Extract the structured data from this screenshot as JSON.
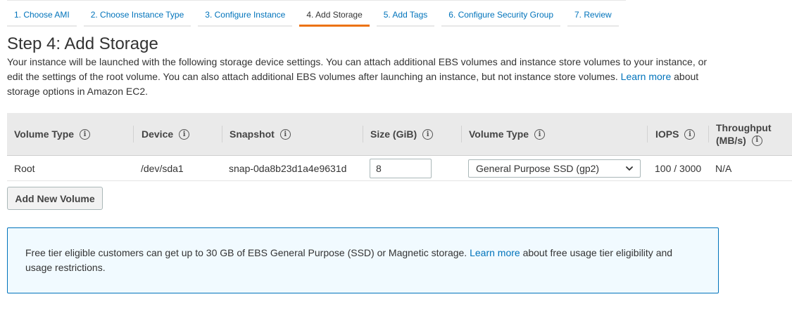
{
  "wizard": {
    "tabs": [
      {
        "label": "1. Choose AMI"
      },
      {
        "label": "2. Choose Instance Type"
      },
      {
        "label": "3. Configure Instance"
      },
      {
        "label": "4. Add Storage"
      },
      {
        "label": "5. Add Tags"
      },
      {
        "label": "6. Configure Security Group"
      },
      {
        "label": "7. Review"
      }
    ],
    "active_tab": "4. Add Storage",
    "active_color": "#ec7211"
  },
  "page": {
    "title": "Step 4: Add Storage",
    "description_part1": "Your instance will be launched with the following storage device settings. You can attach additional EBS volumes and instance store volumes to your instance, or edit the settings of the root volume. You can also attach additional EBS volumes after launching an instance, but not instance store volumes.",
    "learn_more_link": "Learn more",
    "description_part2": "about storage options in Amazon EC2."
  },
  "table": {
    "headers": {
      "volume_type": "Volume Type",
      "device": "Device",
      "snapshot": "Snapshot",
      "size": "Size (GiB)",
      "ebs_volume_type": "Volume Type",
      "iops": "IOPS",
      "throughput_line1": "Throughput",
      "throughput_line2": "(MB/s)"
    },
    "info_icon": "info-icon",
    "rows": [
      {
        "volume_type": "Root",
        "device": "/dev/sda1",
        "snapshot": "snap-0da8b23d1a4e9631d",
        "size": "8",
        "ebs_volume_type": "General Purpose SSD (gp2)",
        "iops": "100 / 3000",
        "throughput": "N/A"
      }
    ]
  },
  "actions": {
    "add_volume_label": "Add New Volume"
  },
  "alert": {
    "text_part1": "Free tier eligible customers can get up to 30 GB of EBS General Purpose (SSD) or Magnetic storage.",
    "learn_more_link": "Learn more",
    "text_part2": "about free usage tier eligibility and usage restrictions.",
    "border_color": "#0073bb"
  }
}
